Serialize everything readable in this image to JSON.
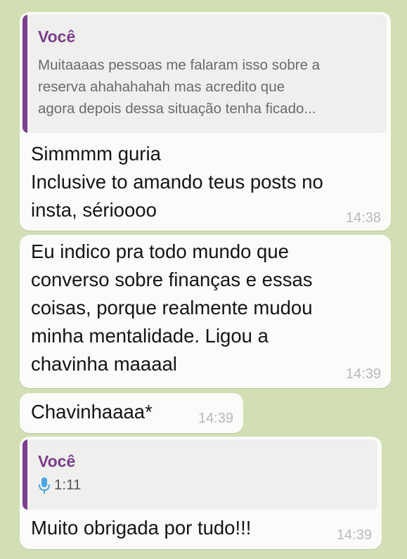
{
  "theme": {
    "background": "#d2dfb4",
    "bubble": "#fbfbfa",
    "quote_bg": "#efefed",
    "quote_accent": "#7a3f8c",
    "author_color": "#7b3e8a",
    "mic_color": "#4aa6e5"
  },
  "messages": [
    {
      "quote": {
        "author": "Você",
        "text": "Muitaaaas pessoas me falaram isso sobre a\nreserva ahahahahah mas acredito que\nagora depois dessa situação tenha ficado..."
      },
      "text": "Simmmm guria\nInclusive to amando teus posts no\ninsta, sérioooo",
      "time": "14:38"
    },
    {
      "text": "Eu indico pra todo mundo que\nconverso sobre finanças e essas\ncoisas, porque realmente mudou\nminha mentalidade. Ligou a\nchavinha maaaal",
      "time": "14:39"
    },
    {
      "text": "Chavinhaaaa*",
      "time": "14:39"
    },
    {
      "quote": {
        "author": "Você",
        "icon": "microphone-icon",
        "duration": "1:11"
      },
      "text": "Muito obrigada por tudo!!!",
      "time": "14:39"
    }
  ]
}
